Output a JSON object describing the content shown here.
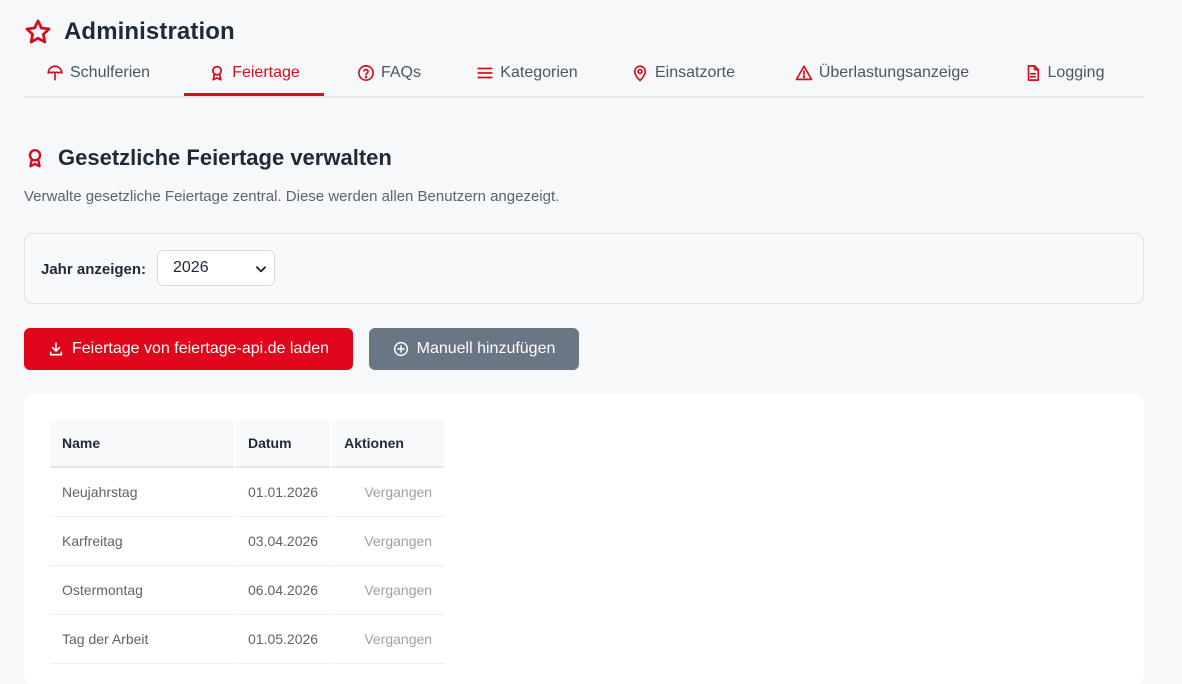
{
  "header": {
    "title": "Administration",
    "icon": "star-icon",
    "accent": "#d1101f"
  },
  "tabs": [
    {
      "label": "Schulferien",
      "icon": "umbrella-icon",
      "active": false
    },
    {
      "label": "Feiertage",
      "icon": "award-icon",
      "active": true
    },
    {
      "label": "FAQs",
      "icon": "question-circle-icon",
      "active": false
    },
    {
      "label": "Kategorien",
      "icon": "menu-lines-icon",
      "active": false
    },
    {
      "label": "Einsatzorte",
      "icon": "map-pin-icon",
      "active": false
    },
    {
      "label": "Überlastungsanzeige",
      "icon": "warning-triangle-icon",
      "active": false
    },
    {
      "label": "Logging",
      "icon": "document-icon",
      "active": false
    }
  ],
  "section": {
    "title": "Gesetzliche Feiertage verwalten",
    "icon": "award-icon",
    "subtitle": "Verwalte gesetzliche Feiertage zentral. Diese werden allen Benutzern angezeigt."
  },
  "filter": {
    "label": "Jahr anzeigen:",
    "selected_year": "2026"
  },
  "actions": {
    "load_label": "Feiertage von feiertage-api.de laden",
    "load_icon": "download-icon",
    "load_color": "#e0061c",
    "add_label": "Manuell hinzufügen",
    "add_icon": "plus-circle-icon",
    "add_color": "#6b7685"
  },
  "table": {
    "columns": [
      "Name",
      "Datum",
      "Aktionen"
    ],
    "rows": [
      {
        "name": "Neujahrstag",
        "date": "01.01.2026",
        "status": "Vergangen"
      },
      {
        "name": "Karfreitag",
        "date": "03.04.2026",
        "status": "Vergangen"
      },
      {
        "name": "Ostermontag",
        "date": "06.04.2026",
        "status": "Vergangen"
      },
      {
        "name": "Tag der Arbeit",
        "date": "01.05.2026",
        "status": "Vergangen"
      }
    ]
  }
}
